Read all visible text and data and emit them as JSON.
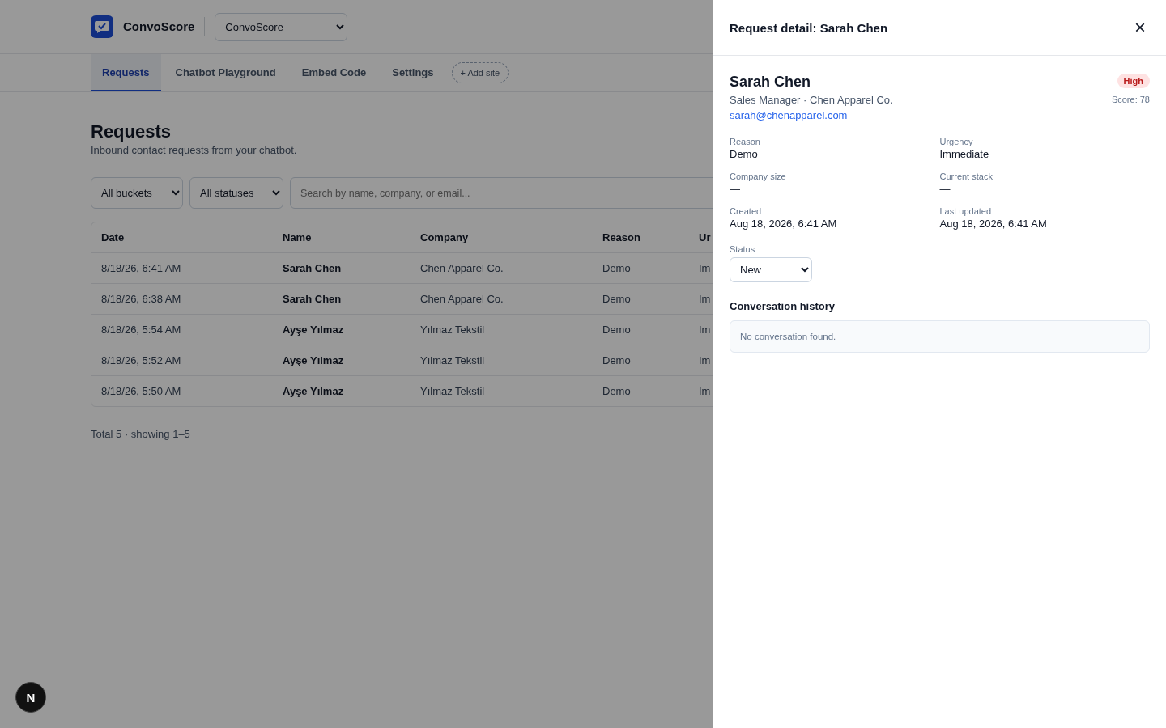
{
  "app": {
    "name": "ConvoScore",
    "site_select": "ConvoScore"
  },
  "tabs": [
    {
      "label": "Requests",
      "selected": true
    },
    {
      "label": "Chatbot Playground",
      "selected": false
    },
    {
      "label": "Embed Code",
      "selected": false
    },
    {
      "label": "Settings",
      "selected": false
    }
  ],
  "add_site": "+ Add site",
  "page": {
    "title": "Requests",
    "subtitle": "Inbound contact requests from your chatbot."
  },
  "filters": {
    "bucket": "All buckets",
    "status": "All statuses",
    "search": {
      "placeholder": "Search by name, company, or email..."
    }
  },
  "table": {
    "columns": [
      "Date",
      "Name",
      "Company",
      "Reason",
      "Ur"
    ],
    "rows": [
      [
        "8/18/26, 6:41 AM",
        "Sarah Chen",
        "Chen Apparel Co.",
        "Demo",
        "Im"
      ],
      [
        "8/18/26, 6:38 AM",
        "Sarah Chen",
        "Chen Apparel Co.",
        "Demo",
        "Im"
      ],
      [
        "8/18/26, 5:54 AM",
        "Ayşe Yılmaz",
        "Yılmaz Tekstil",
        "Demo",
        "Im"
      ],
      [
        "8/18/26, 5:52 AM",
        "Ayşe Yılmaz",
        "Yılmaz Tekstil",
        "Demo",
        "Im"
      ],
      [
        "8/18/26, 5:50 AM",
        "Ayşe Yılmaz",
        "Yılmaz Tekstil",
        "Demo",
        "Im"
      ]
    ]
  },
  "footer": "Total 5 · showing 1–5",
  "dev_badge": "N",
  "drawer": {
    "title": "Request detail: Sarah Chen",
    "close": "×",
    "name": "Sarah Chen",
    "subtitle": "Sales Manager · Chen Apparel Co.",
    "email": "sarah@chenapparel.com",
    "priority": "High",
    "score": "Score: 78",
    "fields": [
      {
        "label": "Reason",
        "value": "Demo"
      },
      {
        "label": "Urgency",
        "value": "Immediate"
      },
      {
        "label": "Company size",
        "value": "—"
      },
      {
        "label": "Current stack",
        "value": "—"
      },
      {
        "label": "Created",
        "value": "Aug 18, 2026, 6:41 AM"
      },
      {
        "label": "Last updated",
        "value": "Aug 18, 2026, 6:41 AM"
      }
    ],
    "status_label": "Status",
    "status_value": "New",
    "history_title": "Conversation history",
    "history_empty": "No conversation found."
  }
}
